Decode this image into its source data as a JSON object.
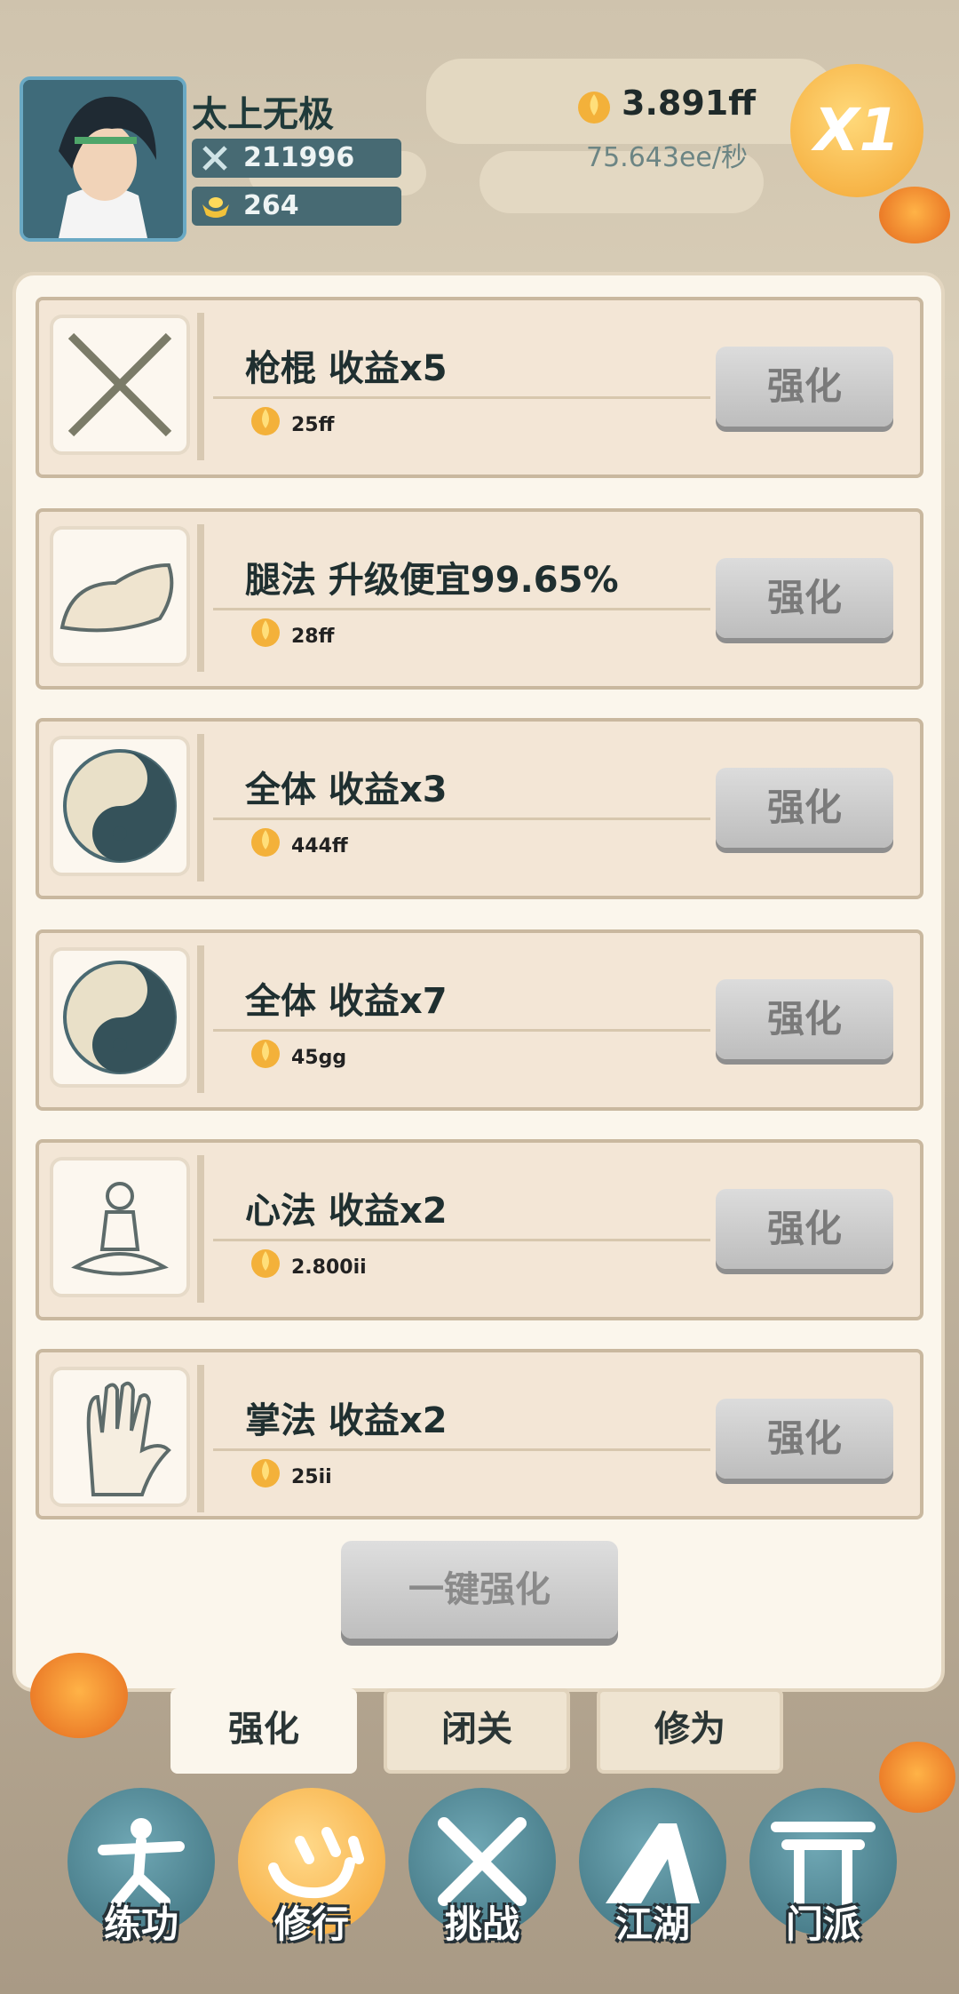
{
  "player": {
    "name": "太上无极",
    "power": "211996",
    "gold": "264"
  },
  "currency": {
    "total": "3.891ff",
    "rate": "75.643ee/秒"
  },
  "multiplier": "X1",
  "upgrades": [
    {
      "title": "枪棍 收益x5",
      "cost": "25ff",
      "icon": "crossed-staff-icon",
      "button": "强化"
    },
    {
      "title": "腿法 升级便宜99.65%",
      "cost": "28ff",
      "icon": "shoe-icon",
      "button": "强化"
    },
    {
      "title": "全体 收益x3",
      "cost": "444ff",
      "icon": "yin-yang-icon",
      "button": "强化"
    },
    {
      "title": "全体 收益x7",
      "cost": "45gg",
      "icon": "yin-yang-icon",
      "button": "强化"
    },
    {
      "title": "心法 收益x2",
      "cost": "2.800ii",
      "icon": "meditation-icon",
      "button": "强化"
    },
    {
      "title": "掌法 收益x2",
      "cost": "25ii",
      "icon": "palm-icon",
      "button": "强化"
    }
  ],
  "one_click_button": "一键强化",
  "tabs": [
    {
      "label": "强化",
      "active": true
    },
    {
      "label": "闭关",
      "active": false
    },
    {
      "label": "修为",
      "active": false
    }
  ],
  "nav": [
    {
      "label": "练功",
      "icon": "training-icon",
      "active": false
    },
    {
      "label": "修行",
      "icon": "heart-mind-icon",
      "active": true
    },
    {
      "label": "挑战",
      "icon": "crossed-swords-icon",
      "active": false
    },
    {
      "label": "江湖",
      "icon": "mountain-icon",
      "active": false
    },
    {
      "label": "门派",
      "icon": "gate-icon",
      "active": false
    }
  ],
  "colors": {
    "accent": "#f5a534",
    "nav": "#3c6f7c",
    "panel": "#fbf6ec"
  }
}
